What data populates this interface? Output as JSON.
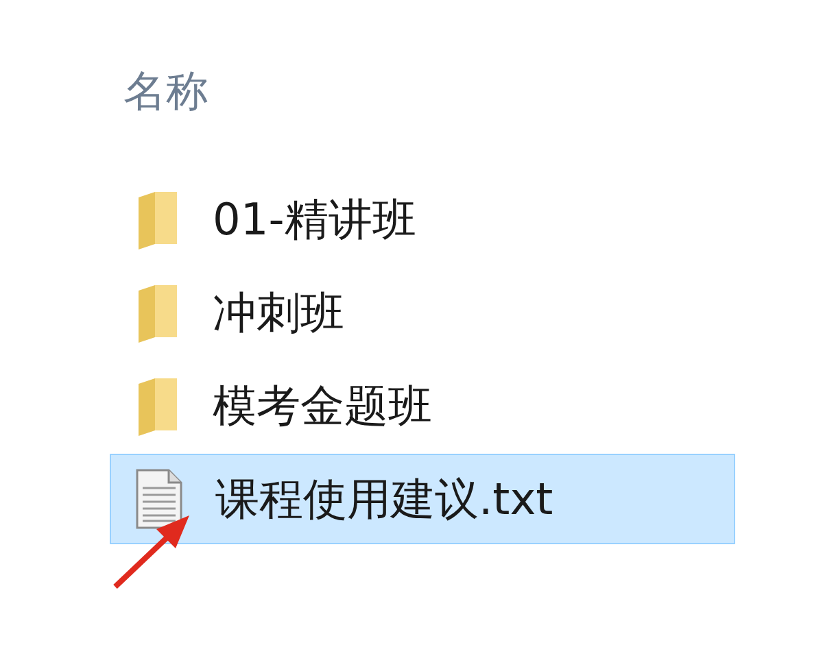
{
  "header": {
    "column_1": "名称"
  },
  "files": [
    {
      "name": "01-精讲班",
      "kind": "folder",
      "selected": false
    },
    {
      "name": "冲刺班",
      "kind": "folder",
      "selected": false
    },
    {
      "name": "模考金题班",
      "kind": "folder",
      "selected": false
    },
    {
      "name": "课程使用建议.txt",
      "kind": "text",
      "selected": true
    }
  ]
}
